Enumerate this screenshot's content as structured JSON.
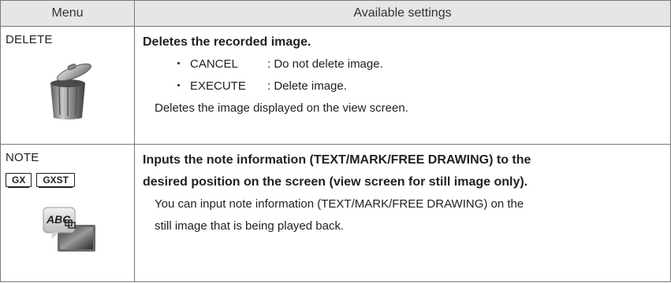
{
  "header": {
    "menu": "Menu",
    "settings": "Available settings"
  },
  "rows": [
    {
      "menu": "DELETE",
      "heading": "Deletes the recorded image.",
      "bullets": [
        {
          "dot": "・",
          "key": "CANCEL",
          "desc": ": Do not delete image."
        },
        {
          "dot": "・",
          "key": "EXECUTE",
          "desc": ": Delete image."
        }
      ],
      "note": "Deletes the image displayed on the view screen.",
      "icon": "trash-can-icon"
    },
    {
      "menu": "NOTE",
      "badges": [
        "GX",
        "GXST"
      ],
      "heading_line1": "Inputs the note information (TEXT/MARK/FREE DRAWING) to the",
      "heading_line2": "desired position on the screen (view screen for still image only).",
      "note_line1": "You can input note information (TEXT/MARK/FREE DRAWING) on the",
      "note_line2": "still image that is being played back.",
      "icon": "abc-note-icon",
      "icon_text": "ABC"
    }
  ]
}
